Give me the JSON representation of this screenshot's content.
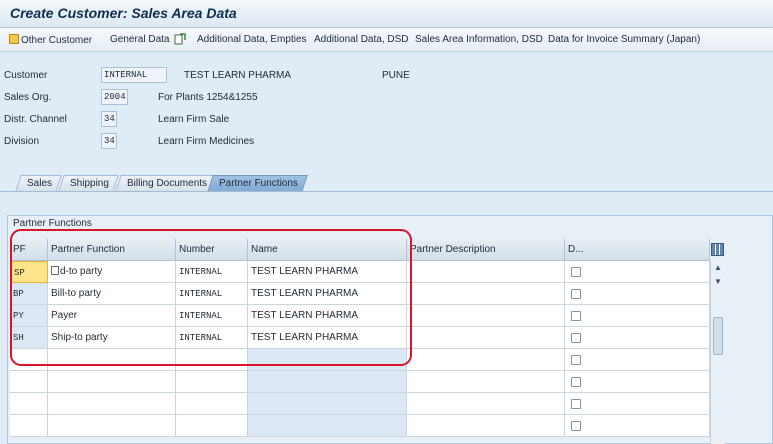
{
  "window": {
    "title": "Create Customer: Sales Area Data"
  },
  "toolbar": {
    "items": [
      {
        "label": "Other Customer",
        "icon": "customer-icon"
      },
      {
        "label": "General Data"
      },
      {
        "label": "Additional Data, Empties",
        "icon": "extras-icon"
      },
      {
        "label": "Additional Data, DSD"
      },
      {
        "label": "Sales Area Information, DSD"
      },
      {
        "label": "Data for Invoice Summary (Japan)"
      }
    ]
  },
  "header": {
    "customer": {
      "label": "Customer",
      "value": "INTERNAL",
      "name": "TEST LEARN PHARMA",
      "city": "PUNE"
    },
    "sales_org": {
      "label": "Sales Org.",
      "value": "2004",
      "text": "For Plants 1254&1255"
    },
    "distr_channel": {
      "label": "Distr. Channel",
      "value": "34",
      "text": "Learn Firm Sale"
    },
    "division": {
      "label": "Division",
      "value": "34",
      "text": "Learn Firm Medicines"
    }
  },
  "tabs": [
    {
      "label": "Sales"
    },
    {
      "label": "Shipping"
    },
    {
      "label": "Billing Documents"
    },
    {
      "label": "Partner Functions",
      "active": true
    }
  ],
  "partner_group": {
    "title": "Partner Functions",
    "columns": [
      "PF",
      "Partner Function",
      "Number",
      "Name",
      "Partner Description",
      "D..."
    ],
    "rows": [
      {
        "pf": "SP",
        "function": "d-to party",
        "number": "INTERNAL",
        "name": "TEST LEARN PHARMA"
      },
      {
        "pf": "BP",
        "function": "Bill-to party",
        "number": "INTERNAL",
        "name": "TEST LEARN PHARMA"
      },
      {
        "pf": "PY",
        "function": "Payer",
        "number": "INTERNAL",
        "name": "TEST LEARN PHARMA"
      },
      {
        "pf": "SH",
        "function": "Ship-to party",
        "number": "INTERNAL",
        "name": "TEST LEARN PHARMA"
      }
    ]
  },
  "colors": {
    "highlight": "#d9142b",
    "active_tab": "#8db6dc",
    "selected_cell": "#ffe48a"
  }
}
